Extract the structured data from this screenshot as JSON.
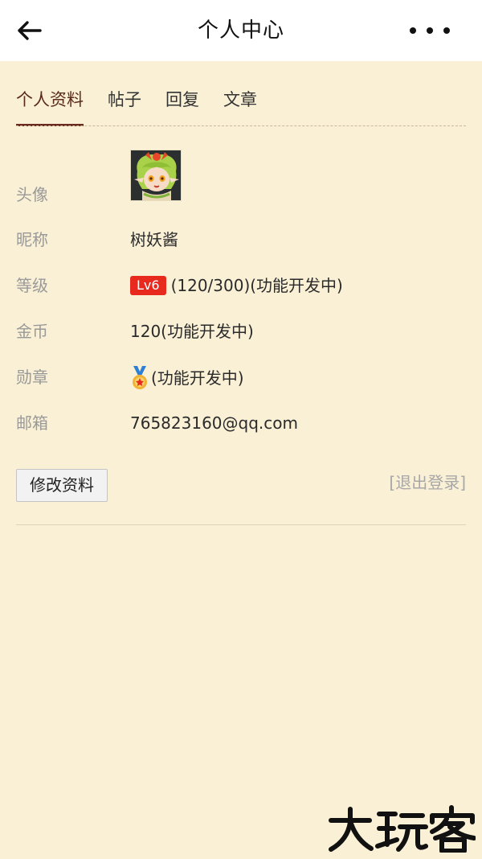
{
  "header": {
    "title": "个人中心",
    "back_icon": "arrow-left-icon",
    "more_icon": "more-dots-icon"
  },
  "tabs": [
    {
      "label": "个人资料",
      "active": true
    },
    {
      "label": "帖子",
      "active": false
    },
    {
      "label": "回复",
      "active": false
    },
    {
      "label": "文章",
      "active": false
    }
  ],
  "profile": {
    "avatar_label": "头像",
    "nickname_label": "昵称",
    "nickname": "树妖酱",
    "level_label": "等级",
    "level_badge": "Lv6",
    "level_progress": "(120/300)(功能开发中)",
    "coins_label": "金币",
    "coins_value": "120(功能开发中)",
    "medal_label": "勋章",
    "medal_icon": "medal-icon",
    "medal_value": "(功能开发中)",
    "email_label": "邮箱",
    "email": "765823160@qq.com"
  },
  "actions": {
    "edit_label": "修改资料",
    "logout_label": "[退出登录]"
  },
  "watermark": {
    "text": "大玩客"
  },
  "colors": {
    "background": "#f9f0d6",
    "header_bg": "#ffffff",
    "tab_active": "#6b2b1e",
    "label": "#999999",
    "level_badge": "#e8291d"
  }
}
